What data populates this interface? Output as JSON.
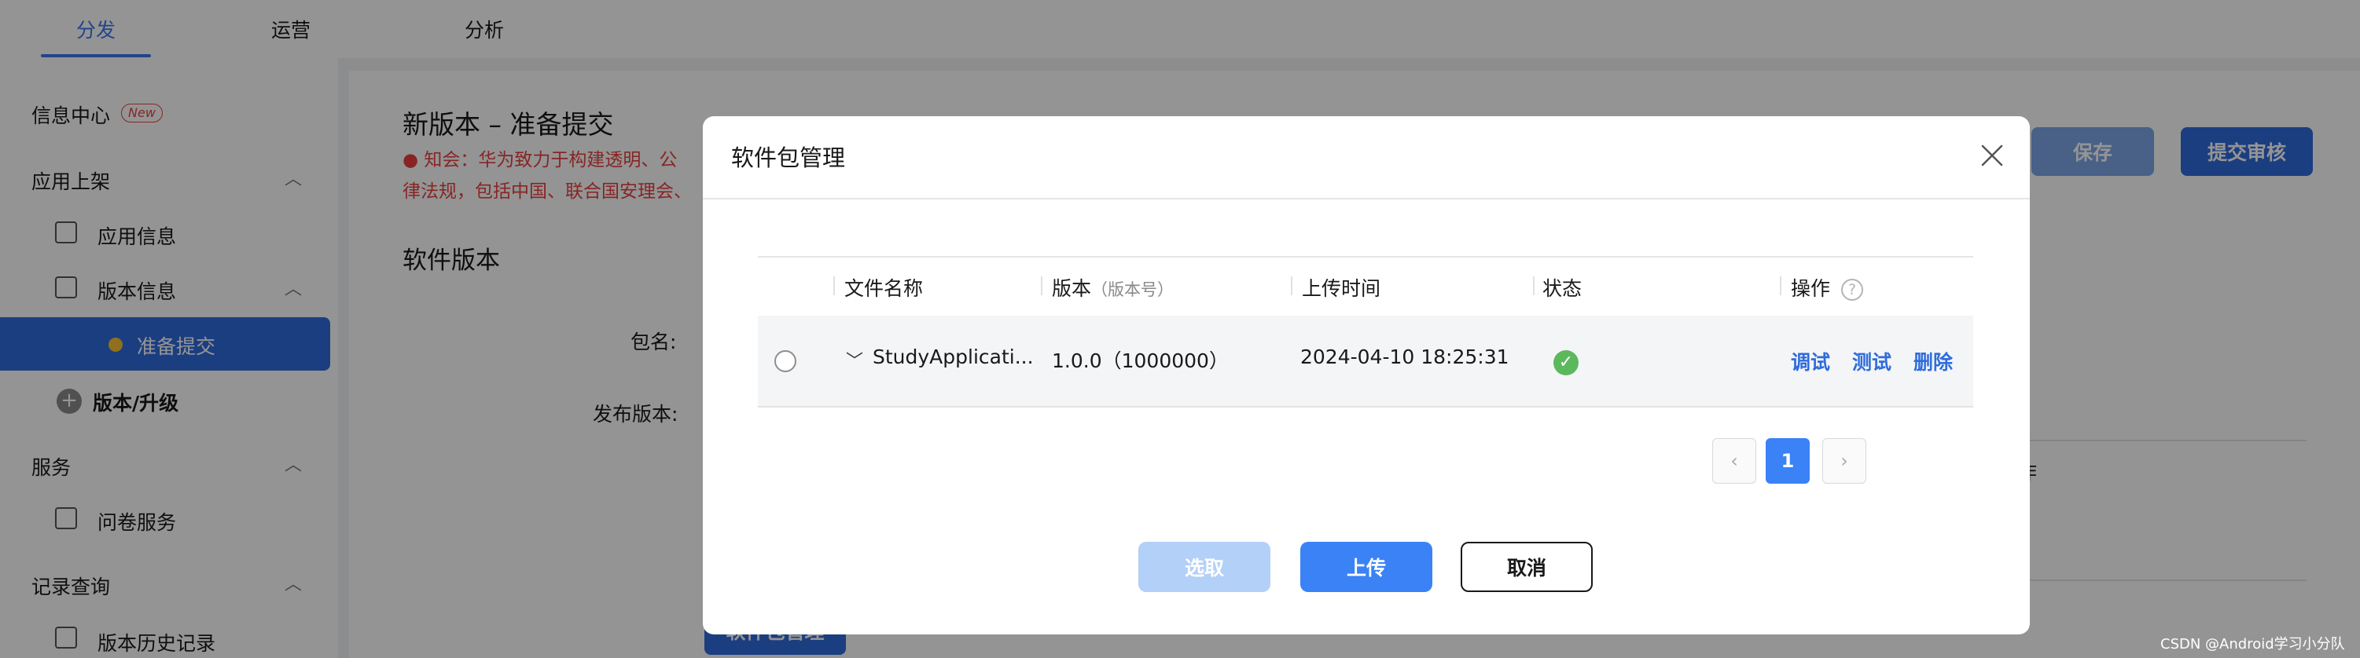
{
  "topnav": {
    "tabs": [
      {
        "label": "分发",
        "active": true
      },
      {
        "label": "运营",
        "active": false
      },
      {
        "label": "分析",
        "active": false
      }
    ]
  },
  "sidebar": {
    "info_center": "信息中心",
    "new_badge": "New",
    "group_app_listing": "应用上架",
    "app_info": "应用信息",
    "version_info": "版本信息",
    "prepare_submit": "准备提交",
    "version_upgrade": "版本/升级",
    "group_service": "服务",
    "survey_service": "问卷服务",
    "group_records": "记录查询",
    "version_history": "版本历史记录"
  },
  "main": {
    "page_title": "新版本 – 准备提交",
    "notice_line1": "知会：华为致力于构建透明、公",
    "notice_line2": "律法规，包括中国、联合国安理会、",
    "section_title": "软件版本",
    "label_package": "包名:",
    "label_release": "发布版本:",
    "save_label": "保存",
    "submit_label": "提交审核",
    "bottom_button_label": "软件包管理",
    "partial_right_text": "作"
  },
  "modal": {
    "title": "软件包管理",
    "columns": {
      "file_name": "文件名称",
      "version": "版本",
      "version_sub": "（版本号）",
      "upload_time": "上传时间",
      "status": "状态",
      "actions": "操作"
    },
    "row": {
      "file_name": "StudyApplicati...",
      "version": "1.0.0（1000000）",
      "upload_time": "2024-04-10 18:25:31",
      "status_icon": "check-circle-icon",
      "action_debug": "调试",
      "action_test": "测试",
      "action_delete": "删除"
    },
    "pagination": {
      "prev": "‹",
      "current": "1",
      "next": "›"
    },
    "buttons": {
      "select": "选取",
      "upload": "上传",
      "cancel": "取消"
    }
  },
  "colors": {
    "accent": "#3a82f6",
    "link": "#2f6cdc",
    "success": "#5cb85c",
    "danger": "#e84141"
  },
  "watermark": "CSDN @Android学习小分队"
}
